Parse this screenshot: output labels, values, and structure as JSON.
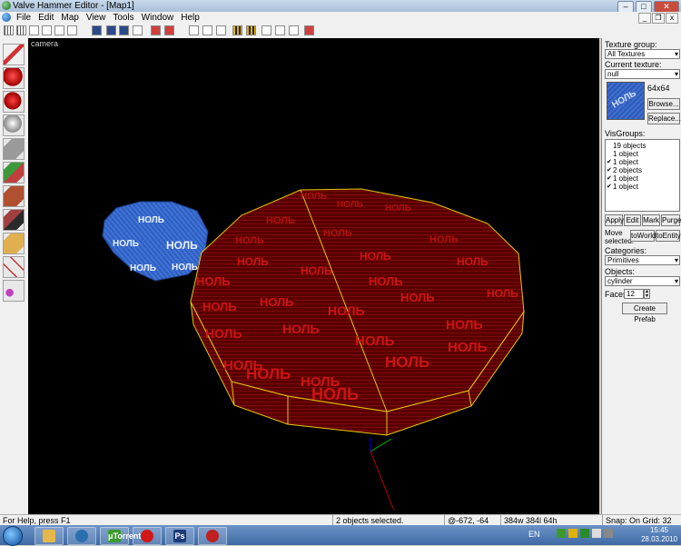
{
  "window": {
    "title": "Valve Hammer Editor - [Map1]",
    "min": "–",
    "max": "□",
    "close": "✕"
  },
  "menu": {
    "items": [
      "File",
      "Edit",
      "Map",
      "View",
      "Tools",
      "Window",
      "Help"
    ]
  },
  "mdi": {
    "min": "_",
    "restore": "❐",
    "close": "x"
  },
  "viewport": {
    "label": "camera",
    "texture_text": "НОЛЬ"
  },
  "panel": {
    "texture_group_label": "Texture group:",
    "texture_group_value": "All Textures",
    "current_texture_label": "Current texture:",
    "current_texture_value": "null",
    "texture_size": "64x64",
    "texture_preview_text": "НОЛЬ",
    "browse": "Browse...",
    "replace": "Replace...",
    "visgroups_label": "VisGroups:",
    "visgroups": [
      "19 objects",
      "1 object",
      "1 object",
      "2 objects",
      "1 object",
      "1 object"
    ],
    "apply": "Apply",
    "edit": "Edit",
    "mark": "Mark",
    "purge": "Purge",
    "move_selected": "Move selected:",
    "to_world": "toWorld",
    "to_entity": "toEntity",
    "categories_label": "Categories:",
    "categories_value": "Primitives",
    "objects_label": "Objects:",
    "objects_value": "cylinder",
    "faces_label": "Faces:",
    "faces_value": "12",
    "create_prefab": "Create Prefab"
  },
  "status": {
    "help": "For Help, press F1",
    "selection": "2 objects selected.",
    "coords": "@-672, -64",
    "size": "384w 384l 64h",
    "snap": "Snap: On Grid: 32"
  },
  "taskbar": {
    "language": "EN",
    "time": "15:45",
    "date": "28.03.2010",
    "apps": [
      "Folder",
      "Hammer",
      "μTorrent",
      "Opera",
      "Ps",
      "Game"
    ]
  }
}
